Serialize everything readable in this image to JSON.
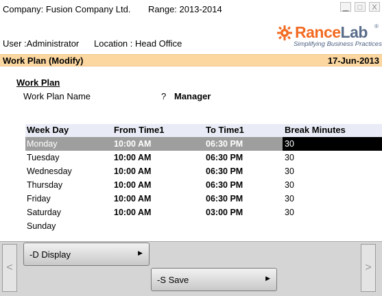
{
  "header": {
    "company": "Company: Fusion Company Ltd.",
    "range": "Range: 2013-2014",
    "user": "User :Administrator",
    "location": "Location : Head Office"
  },
  "window_controls": {
    "minimize": "▁",
    "maximize": "□",
    "close": "X"
  },
  "logo": {
    "brand_part1": "Rance",
    "brand_part2": "Lab",
    "registered": "®",
    "tagline": "Simplifying Business Practices",
    "accent_color": "#f26a21"
  },
  "titlebar": {
    "title": "Work Plan (Modify)",
    "date": "17-Jun-2013",
    "background": "#fcd7a0"
  },
  "form": {
    "section_title": "Work Plan",
    "name_label": "Work Plan Name",
    "name_marker": "?",
    "name_value": "Manager"
  },
  "grid": {
    "columns": [
      "Week Day",
      "From Time1",
      "To Time1",
      "Break Minutes"
    ],
    "rows": [
      {
        "day": "Monday",
        "from": "10:00 AM",
        "to": "06:30 PM",
        "break": "30",
        "selected": true
      },
      {
        "day": "Tuesday",
        "from": "10:00 AM",
        "to": "06:30 PM",
        "break": "30"
      },
      {
        "day": "Wednesday",
        "from": "10:00 AM",
        "to": "06:30 PM",
        "break": "30"
      },
      {
        "day": "Thursday",
        "from": "10:00 AM",
        "to": "06:30 PM",
        "break": "30"
      },
      {
        "day": "Friday",
        "from": "10:00 AM",
        "to": "06:30 PM",
        "break": "30"
      },
      {
        "day": "Saturday",
        "from": "10:00 AM",
        "to": "03:00 PM",
        "break": "30"
      },
      {
        "day": "Sunday",
        "from": "",
        "to": "",
        "break": ""
      }
    ]
  },
  "buttons": {
    "display": "-D Display",
    "save": "-S Save",
    "arrow": "▶",
    "nav_left": "<",
    "nav_right": ">"
  }
}
